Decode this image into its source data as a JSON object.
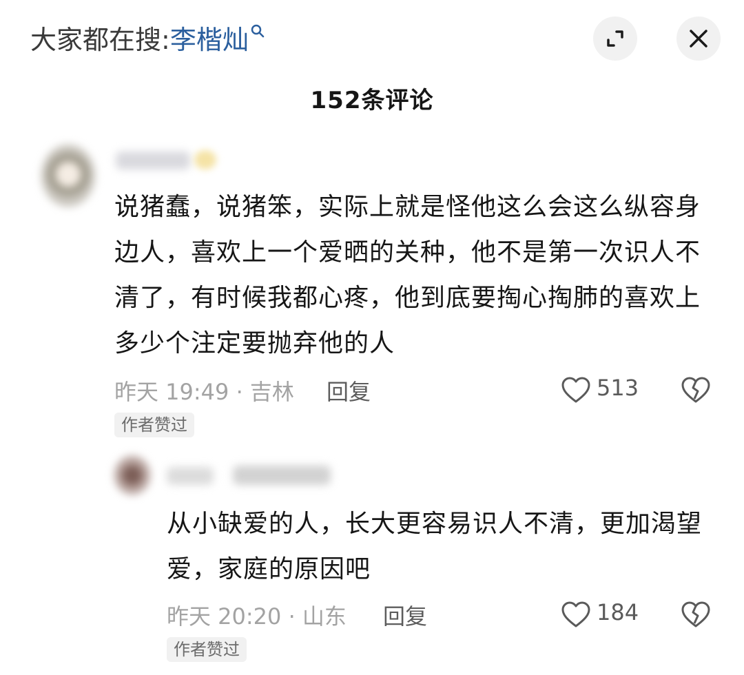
{
  "header": {
    "search_prefix": "大家都在搜:",
    "search_term": "李楷灿",
    "expand_icon": "expand-icon",
    "close_icon": "close-icon"
  },
  "comment_count_label": "152条评论",
  "comments": [
    {
      "text": "说猪蠢，说猪笨，实际上就是怪他这么会这么纵容身边人，喜欢上一个爱晒的关种，他不是第一次识人不清了，有时候我都心疼，他到底要掏心掏肺的喜欢上多少个注定要抛弃他的人",
      "meta": "昨天 19:49 · 吉林",
      "reply_label": "回复",
      "likes": "513",
      "badge": "作者赞过"
    },
    {
      "text": "从小缺爱的人，长大更容易识人不清，更加渴望爱，家庭的原因吧",
      "meta": "昨天 20:20 · 山东",
      "reply_label": "回复",
      "likes": "184",
      "badge": "作者赞过"
    }
  ],
  "colors": {
    "link_blue": "#2b5f9e",
    "muted_gray": "#a3a3a3",
    "badge_bg": "#f1f1f1"
  }
}
